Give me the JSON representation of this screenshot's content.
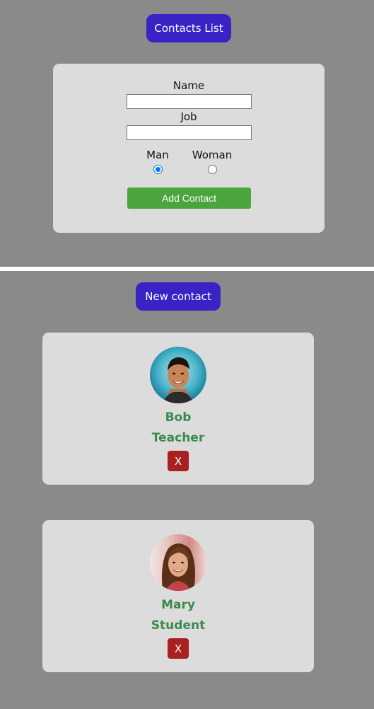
{
  "header": {
    "contacts_list_label": "Contacts List"
  },
  "form": {
    "name_label": "Name",
    "name_value": "",
    "job_label": "Job",
    "job_value": "",
    "gender_options": [
      {
        "label": "Man",
        "selected": true
      },
      {
        "label": "Woman",
        "selected": false
      }
    ],
    "submit_label": "Add Contact"
  },
  "contacts_section": {
    "new_contact_label": "New contact",
    "contacts": [
      {
        "name": "Bob",
        "job": "Teacher",
        "delete_label": "X",
        "avatar": "man-photo"
      },
      {
        "name": "Mary",
        "job": "Student",
        "delete_label": "X",
        "avatar": "woman-photo"
      }
    ]
  },
  "colors": {
    "background": "#8a8a8a",
    "card": "#dcdcdc",
    "primary_button": "#3a23c4",
    "add_button": "#4ca43c",
    "delete_button": "#a82020",
    "contact_text": "#3a8a4e",
    "divider": "#ffffff"
  }
}
